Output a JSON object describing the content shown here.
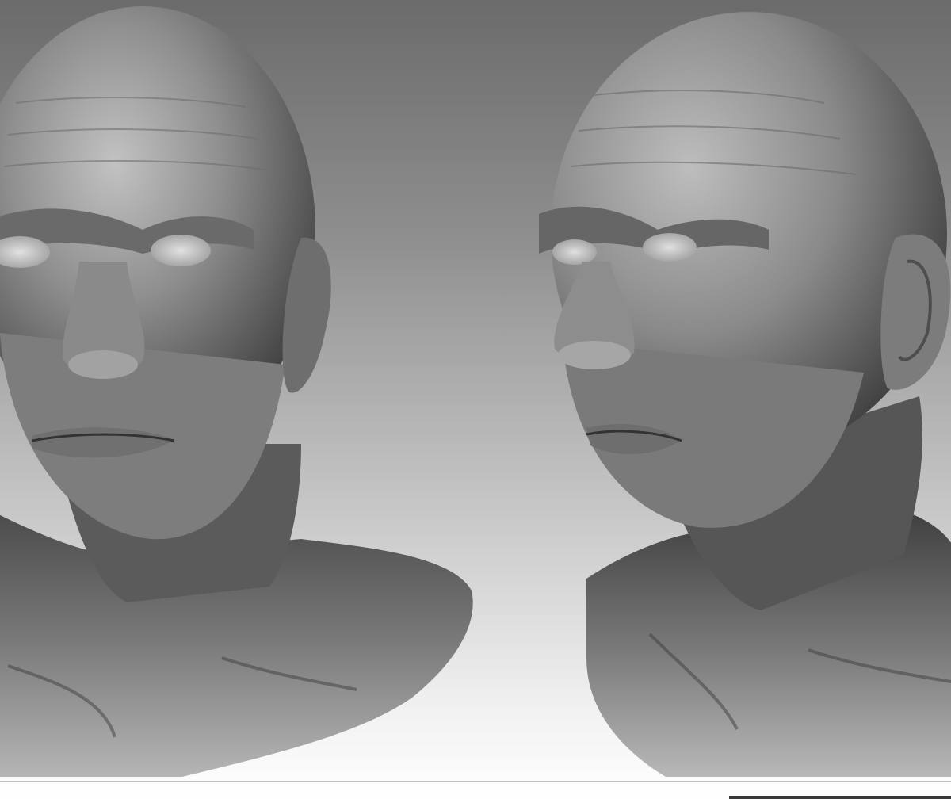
{
  "scene": {
    "background_top_color": "#6b6b6b",
    "background_bottom_color": "#ffffff",
    "clay_color": "#8a8a8a",
    "clay_highlight_color": "#c8c8c8",
    "clay_shadow_color": "#2e2e2e"
  },
  "views": [
    {
      "name": "front-view",
      "icon": "head-bust-front"
    },
    {
      "name": "three-quarter-view",
      "icon": "head-bust-three-quarter"
    }
  ]
}
